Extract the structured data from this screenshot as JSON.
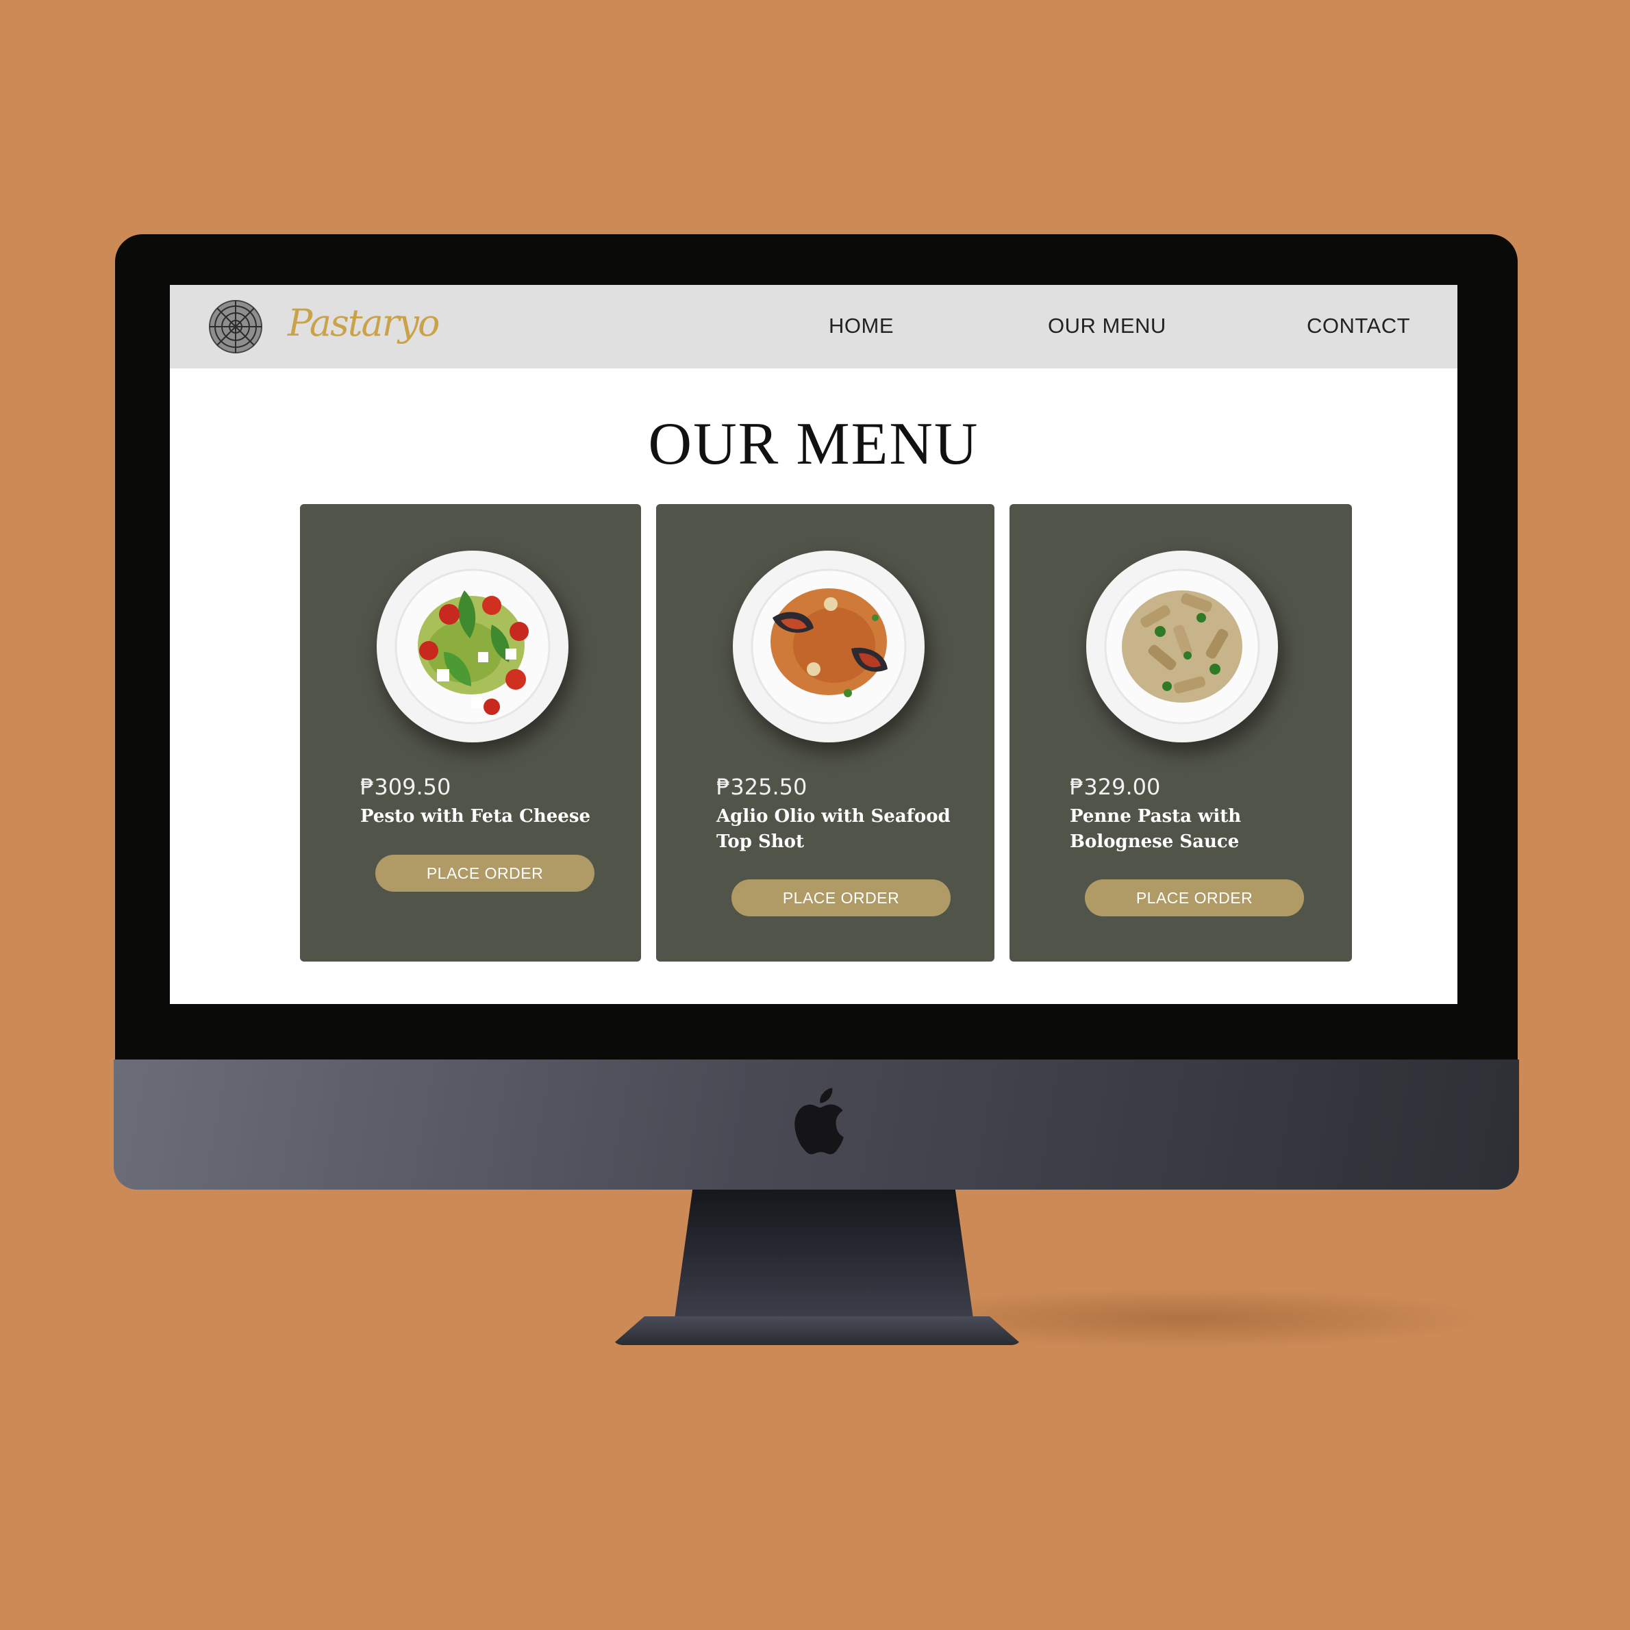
{
  "nav": {
    "brand": "Pastaryo",
    "links": [
      "HOME",
      "OUR MENU",
      "CONTACT"
    ]
  },
  "main": {
    "title": "OUR MENU",
    "items": [
      {
        "price": "₱309.50",
        "name": "Pesto with Feta Cheese",
        "button": "PLACE ORDER"
      },
      {
        "price": "₱325.50",
        "name": "Aglio Olio with Seafood Top Shot",
        "button": "PLACE ORDER"
      },
      {
        "price": "₱329.00",
        "name": "Penne Pasta with Bolognese Sauce",
        "button": "PLACE ORDER"
      }
    ]
  },
  "colors": {
    "background": "#CC8A56",
    "card": "#515449",
    "button": "#b09a66",
    "brand": "#c9a24a",
    "navbar": "#e0e0e0"
  },
  "icons": {
    "logo": "pasta-wheel-logo-icon",
    "device": "apple-logo-icon"
  }
}
